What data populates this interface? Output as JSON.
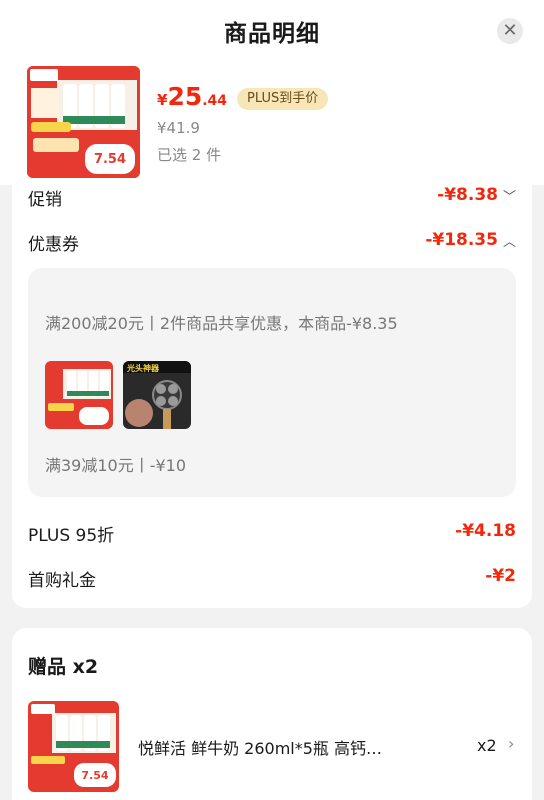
{
  "header": {
    "title": "商品明细",
    "close_icon": "close-icon"
  },
  "product": {
    "price_symbol": "¥",
    "price_integer": "25",
    "price_decimal": ".44",
    "plus_badge": "PLUS到手价",
    "original_price": "¥41.9",
    "selected_text": "已选 2 件",
    "thumb_brand": "悦鲜活",
    "thumb_price": "7.54",
    "thumb_cta": "立即下单"
  },
  "discounts": {
    "promo_label": "促销",
    "promo_value": "-¥8.38",
    "coupon_label": "优惠券",
    "coupon_value": "-¥18.35",
    "coupon_line1": "满200减20元丨2件商品共享优惠，本商品-¥8.35",
    "coupon_line2": "满39减10元丨-¥10",
    "shaver_thumb_text": "光头神器",
    "plus_label": "PLUS 95折",
    "plus_value": "-¥4.18",
    "first_label": "首购礼金",
    "first_value": "-¥2"
  },
  "gift": {
    "title": "赠品 x2",
    "name": "悦鲜活 鲜牛奶  260ml*5瓶 高钙…",
    "qty": "x2"
  },
  "colors": {
    "accent_red": "#f2270c",
    "plus_gold": "#f7e7b8",
    "brand_red": "#e53a2f"
  }
}
